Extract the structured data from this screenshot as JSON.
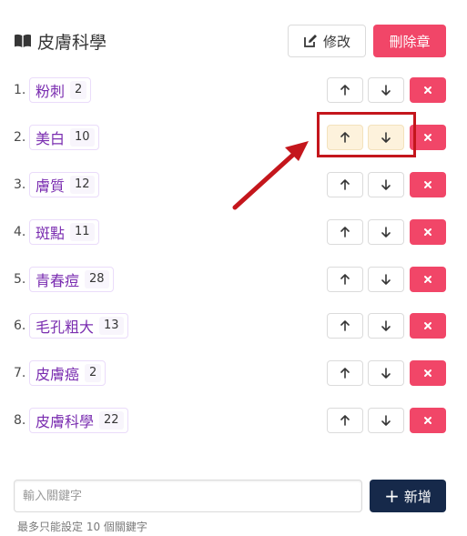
{
  "chapter": {
    "title": "皮膚科學",
    "edit_label": "修改",
    "delete_label": "刪除章"
  },
  "keywords": [
    {
      "index": "1.",
      "name": "粉刺",
      "count": "2"
    },
    {
      "index": "2.",
      "name": "美白",
      "count": "10"
    },
    {
      "index": "3.",
      "name": "膚質",
      "count": "12"
    },
    {
      "index": "4.",
      "name": "斑點",
      "count": "11"
    },
    {
      "index": "5.",
      "name": "青春痘",
      "count": "28"
    },
    {
      "index": "6.",
      "name": "毛孔粗大",
      "count": "13"
    },
    {
      "index": "7.",
      "name": "皮膚癌",
      "count": "2"
    },
    {
      "index": "8.",
      "name": "皮膚科學",
      "count": "22"
    }
  ],
  "controls": {
    "up_icon": "arrow-up-icon",
    "down_icon": "arrow-down-icon",
    "delete_icon": "close-icon"
  },
  "add_form": {
    "placeholder": "輸入關鍵字",
    "value": "",
    "add_label": "新增",
    "help_text": "最多只能設定 10 個關鍵字"
  },
  "colors": {
    "danger": "#f14668",
    "primary_dark": "#16294a",
    "tag_text": "#7a2db0",
    "highlight_box": "#c4161c",
    "highlight_button_bg": "#fdf2dc"
  }
}
